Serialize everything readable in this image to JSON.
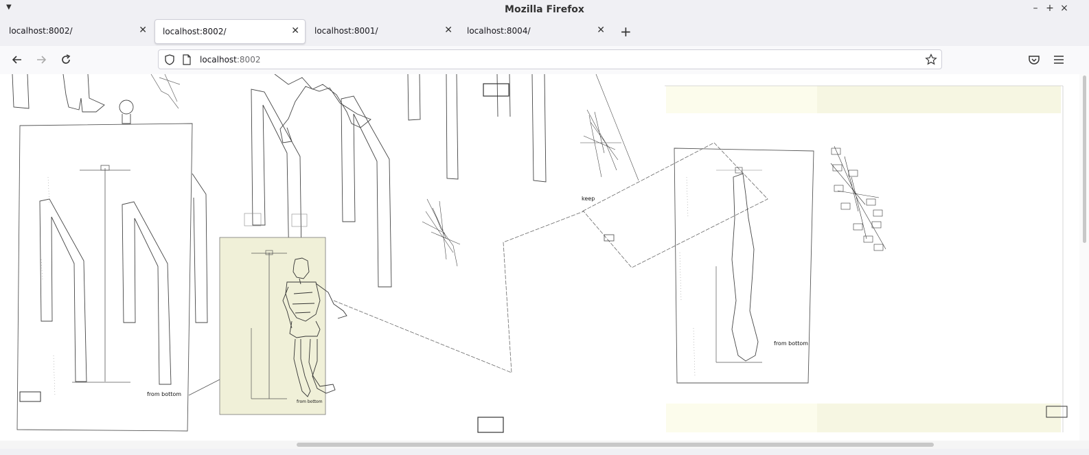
{
  "window": {
    "title": "Mozilla Firefox"
  },
  "tabs": [
    {
      "label": "localhost:8002/",
      "active": false
    },
    {
      "label": "localhost:8002/",
      "active": true
    },
    {
      "label": "localhost:8001/",
      "active": false
    },
    {
      "label": "localhost:8004/",
      "active": false
    }
  ],
  "urlbar": {
    "host": "localhost",
    "port": ":8002"
  },
  "canvas": {
    "labels": {
      "keep": "keep",
      "from_bottom_left": "from bottom",
      "from_bottom_middle": "from bottom",
      "from_bottom_right": "from bottom"
    }
  },
  "colors": {
    "highlight_panel": "#f0f0d8",
    "soft_band": "#fcfcec",
    "soft_band_dark": "#f6f6e2",
    "chrome": "#f0f0f4",
    "line": "#555555"
  },
  "icons": [
    "menu-icon",
    "minimize-icon",
    "maximize-icon",
    "close-icon",
    "back-icon",
    "forward-icon",
    "reload-icon",
    "shield-icon",
    "page-icon",
    "star-icon",
    "pocket-icon",
    "app-menu-icon",
    "new-tab-icon",
    "tab-close-icon"
  ]
}
